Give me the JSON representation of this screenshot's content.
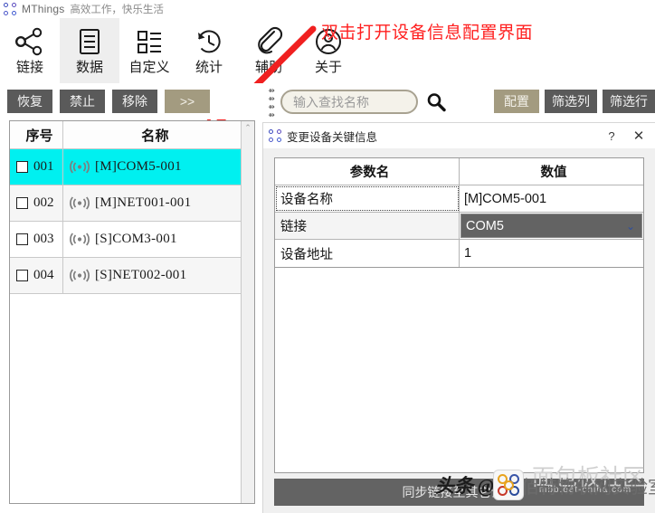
{
  "titlebar": {
    "logo_icon": "mthings-logo-icon",
    "app_name": "MThings",
    "slogan": "高效工作，快乐生活"
  },
  "ribbon": {
    "tabs": [
      {
        "label": "链接",
        "icon": "share-nodes-icon",
        "active": false
      },
      {
        "label": "数据",
        "icon": "list-document-icon",
        "active": true
      },
      {
        "label": "自定义",
        "icon": "layout-blocks-icon",
        "active": false
      },
      {
        "label": "统计",
        "icon": "clock-history-icon",
        "active": false
      },
      {
        "label": "辅助",
        "icon": "paperclip-icon",
        "active": false
      },
      {
        "label": "关于",
        "icon": "user-circle-icon",
        "active": false
      }
    ]
  },
  "annotation": {
    "text": "双击打开设备信息配置界面",
    "color": "#ff2020",
    "arrow_icon": "red-arrow-icon"
  },
  "actionbar": {
    "buttons": [
      {
        "label": "恢复",
        "style": "gray"
      },
      {
        "label": "禁止",
        "style": "gray"
      },
      {
        "label": "移除",
        "style": "gray"
      },
      {
        "label": ">>",
        "style": "tan"
      }
    ],
    "splitter_icon": "splitter-grip-icon"
  },
  "search": {
    "placeholder": "输入查找名称",
    "value": "",
    "icon": "search-icon"
  },
  "right_buttons": [
    {
      "label": "配置",
      "style": "tan"
    },
    {
      "label": "筛选列",
      "style": "gray"
    },
    {
      "label": "筛选行",
      "style": "gray"
    }
  ],
  "device_list": {
    "columns": [
      "序号",
      "名称"
    ],
    "scroll_up_icon": "chevron-up-icon",
    "rows": [
      {
        "index": "001",
        "icon": "signal-broadcast-icon",
        "name": "[M]COM5-001",
        "selected": true,
        "checked": false
      },
      {
        "index": "002",
        "icon": "signal-broadcast-icon",
        "name": "[M]NET001-001",
        "selected": false,
        "checked": false
      },
      {
        "index": "003",
        "icon": "signal-broadcast-icon",
        "name": "[S]COM3-001",
        "selected": false,
        "checked": false
      },
      {
        "index": "004",
        "icon": "signal-broadcast-icon",
        "name": "[S]NET002-001",
        "selected": false,
        "checked": false
      }
    ],
    "selected_row_color": "#00f0f0"
  },
  "dialog": {
    "logo_icon": "mthings-logo-icon",
    "title": "变更设备关键信息",
    "help_label": "?",
    "close_label": "✕",
    "table": {
      "columns": [
        "参数名",
        "数值"
      ],
      "rows": [
        {
          "key": "设备名称",
          "value": "[M]COM5-001",
          "type": "text",
          "focused": true
        },
        {
          "key": "链接",
          "value": "COM5",
          "type": "combo",
          "focused": false
        },
        {
          "key": "设备地址",
          "value": "1",
          "type": "text",
          "focused": false
        }
      ]
    },
    "sync_button": "同步链接至其它设备",
    "combo_chevron_icon": "chevron-down-icon"
  },
  "watermark": {
    "toutiao": "头条 @",
    "lab": "亿佰特物联网实验室",
    "bbs": "面包板社区",
    "bbs_sub": "mbb.eet-china.com",
    "logo_icon": "eet-logo-icon"
  }
}
